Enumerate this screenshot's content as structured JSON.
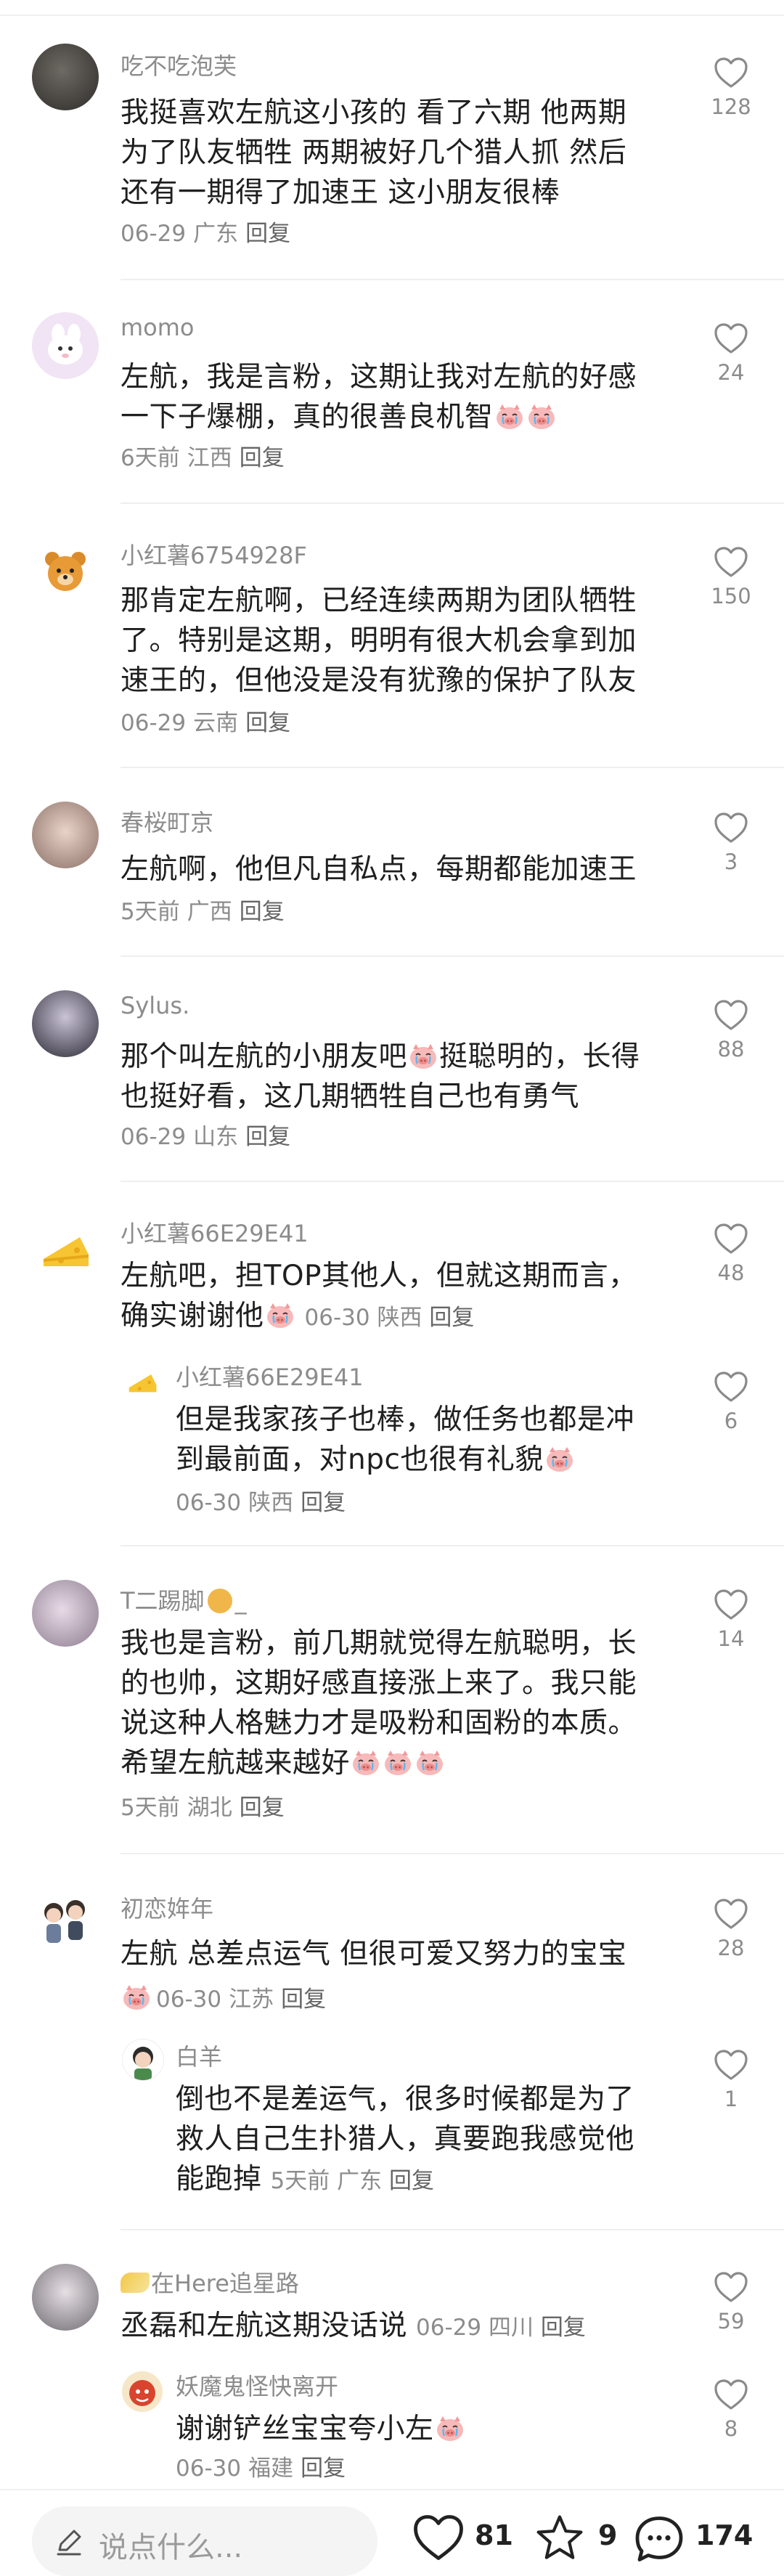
{
  "comments": [
    {
      "username": "吃不吃泡芙",
      "lines": [
        "我挺喜欢左航这小孩的 看了六期 他两期",
        "为了队友牺牲 两期被好几个猎人抓 然后",
        "还有一期得了加速王 这小朋友很棒"
      ],
      "date": "06-29",
      "location": "广东",
      "reply": "回复",
      "likes": "128"
    },
    {
      "username": "momo",
      "lines": [
        "左航，我是言粉，这期让我对左航的好感",
        "一下子爆棚，真的很善良机智"
      ],
      "date": "6天前",
      "location": "江西",
      "reply": "回复",
      "likes": "24"
    },
    {
      "username": "小红薯6754928F",
      "lines": [
        "那肯定左航啊，已经连续两期为团队牺牲",
        "了。特别是这期，明明有很大机会拿到加",
        "速王的，但他没是没有犹豫的保护了队友"
      ],
      "date": "06-29",
      "location": "云南",
      "reply": "回复",
      "likes": "150"
    },
    {
      "username": "春桜町京",
      "lines": [
        "左航啊，他但凡自私点，每期都能加速王"
      ],
      "date": "5天前",
      "location": "广西",
      "reply": "回复",
      "likes": "3"
    },
    {
      "username": "Sylus.",
      "lines": [
        "那个叫左航的小朋友吧",
        "挺聪明的，长得",
        "也挺好看，这几期牺牲自己也有勇气"
      ],
      "date": "06-29",
      "location": "山东",
      "reply": "回复",
      "likes": "88"
    },
    {
      "username": "小红薯66E29E41",
      "lines": [
        "左航吧，担TOP其他人，但就这期而言，",
        "确实谢谢他"
      ],
      "date": "06-30",
      "location": "陕西",
      "reply": "回复",
      "likes": "48",
      "sub": {
        "username": "小红薯66E29E41",
        "lines": [
          "但是我家孩子也棒，做任务也都是冲",
          "到最前面，对npc也很有礼貌"
        ],
        "date": "06-30",
        "location": "陕西",
        "reply": "回复",
        "likes": "6"
      }
    },
    {
      "username": "T二踢脚",
      "username_suffix": "_",
      "lines": [
        "我也是言粉，前几期就觉得左航聪明，长",
        "的也帅，这期好感直接涨上来了。我只能",
        "说这种人格魅力才是吸粉和固粉的本质。",
        "希望左航越来越好"
      ],
      "date": "5天前",
      "location": "湖北",
      "reply": "回复",
      "likes": "14"
    },
    {
      "username": "初恋姩年",
      "lines": [
        "左航 总差点运气 但很可爱又努力的宝宝"
      ],
      "date": "06-30",
      "location": "江苏",
      "reply": "回复",
      "likes": "28",
      "sub": {
        "username": "白羊",
        "lines": [
          "倒也不是差运气，很多时候都是为了",
          "救人自己生扑猎人，真要跑我感觉他",
          "能跑掉"
        ],
        "date": "5天前",
        "location": "广东",
        "reply": "回复",
        "likes": "1"
      }
    },
    {
      "username": "在Here追星路",
      "lines": [
        "丞磊和左航这期没话说"
      ],
      "date": "06-29",
      "location": "四川",
      "reply": "回复",
      "likes": "59",
      "sub": {
        "username": "妖魔鬼怪快离开",
        "lines": [
          "谢谢铲丝宝宝夸小左"
        ],
        "date": "06-30",
        "location": "福建",
        "reply": "回复",
        "likes": "8"
      }
    }
  ],
  "bottom_bar": {
    "input_placeholder": "说点什么...",
    "likes": "81",
    "collects": "9",
    "comments": "174"
  },
  "icons": {
    "like": "heart-outline-icon",
    "collect": "star-outline-icon",
    "comment": "chat-bubble-icon",
    "input": "pencil-icon",
    "emoji": "crying-pig-emoji"
  }
}
